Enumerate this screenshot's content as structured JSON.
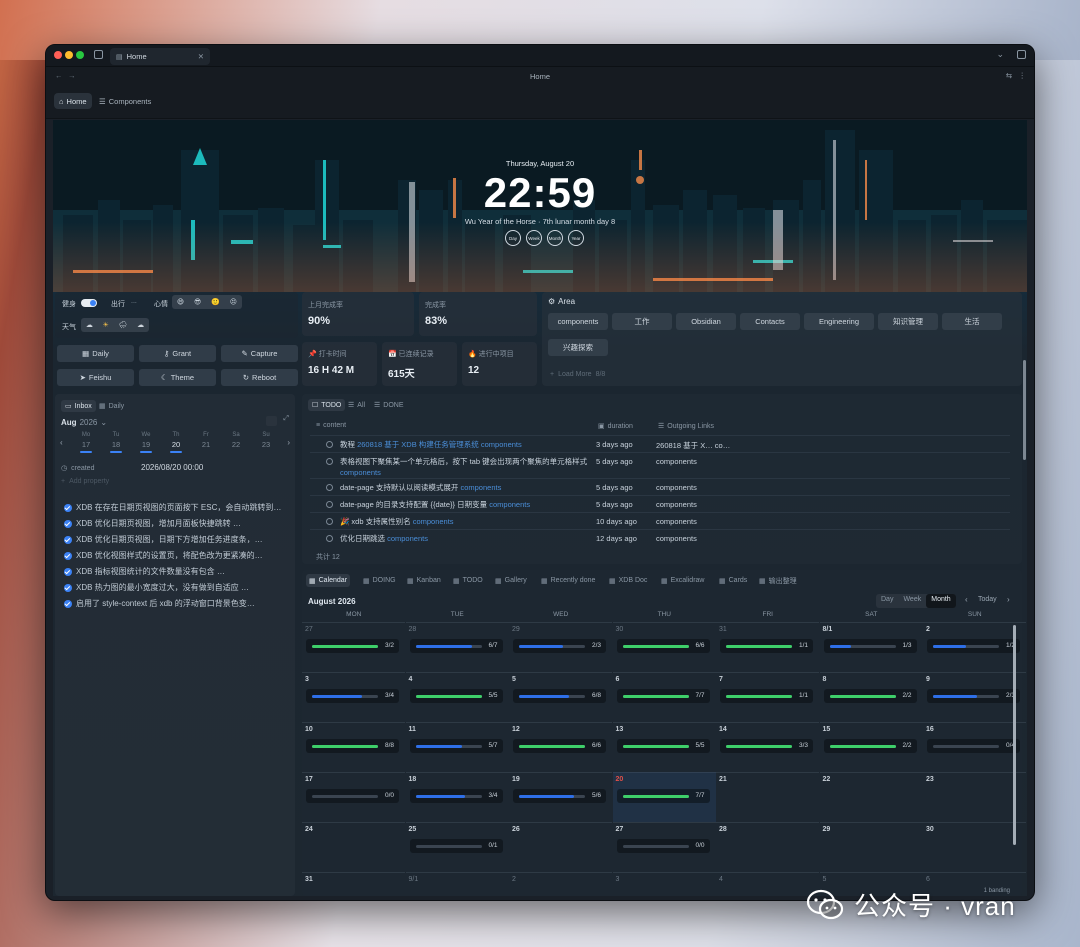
{
  "window": {
    "tab_title": "Home",
    "page_title": "Home",
    "ribbon_tabs": [
      "Home",
      "Components"
    ]
  },
  "header": {
    "date": "Thursday, August 20",
    "time": "22:59",
    "lunar": "Wu Year of the Horse · 7th lunar month day 8",
    "rings": [
      "Day",
      "Week",
      "Month",
      "Year"
    ]
  },
  "habits": {
    "fitness_label": "健身",
    "outing_label": "出行",
    "outing_value": "...",
    "mood_label": "心情",
    "weather_label": "天气",
    "mood_icons": [
      "😄",
      "😎",
      "🙂",
      "😣"
    ],
    "weather_icons": [
      "☁",
      "☀",
      "🌧",
      "☁"
    ]
  },
  "quick_actions": [
    "Daily",
    "Grant",
    "Capture",
    "Feishu",
    "Theme",
    "Reboot"
  ],
  "stats": [
    {
      "label": "上月完成率",
      "value": "90%"
    },
    {
      "label": "完成率",
      "value": "83%"
    },
    {
      "label": "打卡时间",
      "value": "16 H 42 M"
    },
    {
      "label": "已连续记录",
      "value": "615天"
    },
    {
      "label": "进行中项目",
      "value": "12"
    }
  ],
  "area": {
    "title": "Area",
    "items": [
      "components",
      "工作",
      "Obsidian",
      "Contacts",
      "Engineering",
      "知识管理",
      "生活",
      "兴趣探索"
    ],
    "load_more": "Load More",
    "load_more_count": "8/8"
  },
  "inbox": {
    "tabs": [
      "Inbox",
      "Daily"
    ],
    "month": "Aug",
    "year": "2026",
    "week_labels": [
      "Mo",
      "Tu",
      "We",
      "Th",
      "Fr",
      "Sa",
      "Su"
    ],
    "week_days": [
      "17",
      "18",
      "19",
      "20",
      "21",
      "22",
      "23"
    ],
    "created_label": "created",
    "created_value": "2026/08/20 00:00",
    "add_property": "Add property",
    "tasks": [
      "XDB 在存在日期页视图的页面按下 ESC，会自动跳转到…",
      "XDB 优化日期页视图，增加月面板快捷跳转 …",
      "XDB 优化日期页视图，日期下方增加任务进度条，…",
      "XDB 优化视图样式的设置页，将配色改为更紧凑的…",
      "XDB 指标视图统计的文件数量没有包含 …",
      "XDB 热力图的最小宽度过大，没有做到自适应 …",
      "启用了 style-context 后 xdb 的浮动窗口背景色变…"
    ]
  },
  "todo": {
    "tabs": [
      "TODO",
      "All",
      "DONE"
    ],
    "columns": [
      "content",
      "duration",
      "Outgoing Links"
    ],
    "rows": [
      {
        "text": "教程",
        "link": "260818 基于 XDB 构建任务管理系统",
        "tag": "components",
        "duration": "3 days ago",
        "outlink": "260818 基于 X… co…"
      },
      {
        "text": "表格视图下聚焦某一个单元格后，按下 tab 键会出现两个聚焦的单元格样式",
        "link": "",
        "tag": "components",
        "duration": "5 days ago",
        "outlink": "components"
      },
      {
        "text": "date-page 支持默认以阅读模式展开",
        "link": "",
        "tag": "components",
        "duration": "5 days ago",
        "outlink": "components"
      },
      {
        "text": "date-page 的目录支持配置 {{date}} 日期变量",
        "link": "",
        "tag": "components",
        "duration": "5 days ago",
        "outlink": "components"
      },
      {
        "text": "🎉 xdb 支持属性别名",
        "link": "",
        "tag": "components",
        "duration": "10 days ago",
        "outlink": "components"
      },
      {
        "text": "优化日期跳选",
        "link": "",
        "tag": "components",
        "duration": "12 days ago",
        "outlink": "components"
      }
    ],
    "footer": "共计 12"
  },
  "views": {
    "tabs": [
      "Calendar",
      "DOING",
      "Kanban",
      "TODO",
      "Gallery",
      "Recently done",
      "XDB Doc",
      "Excalidraw",
      "Cards",
      "输出整理"
    ],
    "month_title": "August 2026",
    "modes": [
      "Day",
      "Week",
      "Month"
    ],
    "active_mode": "Month",
    "today_label": "Today",
    "weekdays": [
      "MON",
      "TUE",
      "WED",
      "THU",
      "FRI",
      "SAT",
      "SUN"
    ],
    "weeks": [
      [
        {
          "d": "27",
          "dim": true,
          "p": "3/2",
          "f": 1,
          "c": "#3ecf6a"
        },
        {
          "d": "28",
          "dim": true,
          "p": "6/7",
          "f": 0.86,
          "c": "#2e6fe8"
        },
        {
          "d": "29",
          "dim": true,
          "p": "2/3",
          "f": 0.67,
          "c": "#2e6fe8"
        },
        {
          "d": "30",
          "dim": true,
          "p": "6/6",
          "f": 1,
          "c": "#3ecf6a"
        },
        {
          "d": "31",
          "dim": true,
          "p": "1/1",
          "f": 1,
          "c": "#3ecf6a"
        },
        {
          "d": "8/1",
          "dim": false,
          "p": "1/3",
          "f": 0.33,
          "c": "#2e6fe8"
        },
        {
          "d": "2",
          "dim": false,
          "p": "1/2",
          "f": 0.5,
          "c": "#2e6fe8"
        }
      ],
      [
        {
          "d": "3",
          "p": "3/4",
          "f": 0.75,
          "c": "#2e6fe8"
        },
        {
          "d": "4",
          "p": "5/5",
          "f": 1,
          "c": "#3ecf6a"
        },
        {
          "d": "5",
          "p": "6/8",
          "f": 0.75,
          "c": "#2e6fe8"
        },
        {
          "d": "6",
          "p": "7/7",
          "f": 1,
          "c": "#3ecf6a"
        },
        {
          "d": "7",
          "p": "1/1",
          "f": 1,
          "c": "#3ecf6a"
        },
        {
          "d": "8",
          "p": "2/2",
          "f": 1,
          "c": "#3ecf6a"
        },
        {
          "d": "9",
          "p": "2/3",
          "f": 0.67,
          "c": "#2e6fe8"
        }
      ],
      [
        {
          "d": "10",
          "p": "8/8",
          "f": 1,
          "c": "#3ecf6a"
        },
        {
          "d": "11",
          "p": "5/7",
          "f": 0.71,
          "c": "#2e6fe8"
        },
        {
          "d": "12",
          "p": "6/6",
          "f": 1,
          "c": "#3ecf6a"
        },
        {
          "d": "13",
          "p": "5/5",
          "f": 1,
          "c": "#3ecf6a"
        },
        {
          "d": "14",
          "p": "3/3",
          "f": 1,
          "c": "#3ecf6a"
        },
        {
          "d": "15",
          "p": "2/2",
          "f": 1,
          "c": "#3ecf6a"
        },
        {
          "d": "16",
          "p": "0/4",
          "f": 0,
          "c": "#2e6fe8"
        }
      ],
      [
        {
          "d": "17",
          "p": "0/0",
          "f": 0,
          "c": "#2e6fe8"
        },
        {
          "d": "18",
          "p": "3/4",
          "f": 0.75,
          "c": "#2e6fe8"
        },
        {
          "d": "19",
          "p": "5/6",
          "f": 0.83,
          "c": "#2e6fe8"
        },
        {
          "d": "20",
          "today": true,
          "p": "7/7",
          "f": 1,
          "c": "#3ecf6a"
        },
        {
          "d": "21"
        },
        {
          "d": "22"
        },
        {
          "d": "23"
        }
      ],
      [
        {
          "d": "24"
        },
        {
          "d": "25",
          "p": "0/1",
          "f": 0,
          "c": "#2e6fe8"
        },
        {
          "d": "26"
        },
        {
          "d": "27",
          "p": "0/0",
          "f": 0,
          "c": "#2e6fe8"
        },
        {
          "d": "28"
        },
        {
          "d": "29"
        },
        {
          "d": "30"
        }
      ],
      [
        {
          "d": "31"
        },
        {
          "d": "9/1",
          "dim": true
        },
        {
          "d": "2",
          "dim": true
        },
        {
          "d": "3",
          "dim": true
        },
        {
          "d": "4",
          "dim": true
        },
        {
          "d": "5",
          "dim": true
        },
        {
          "d": "6",
          "dim": true
        }
      ]
    ],
    "footer_right": "1 banding"
  },
  "watermark": {
    "text": "公众号 · vran"
  },
  "colors": {
    "accent": "#3b82f6",
    "done": "#3ecf6a",
    "progress": "#2e6fe8",
    "today": "#e0504a"
  }
}
